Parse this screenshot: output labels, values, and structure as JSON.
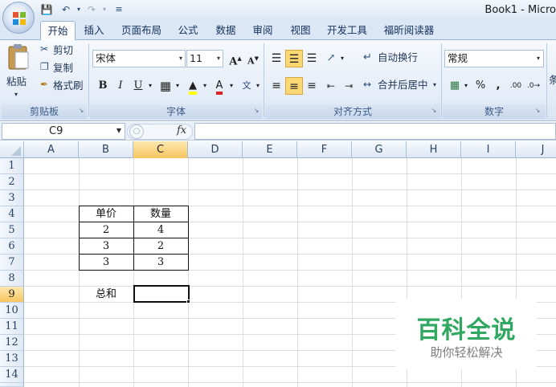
{
  "app": {
    "window_title": "Book1 - Micro",
    "quick_access": {
      "save_icon": "save-icon",
      "undo_icon": "undo-icon",
      "redo_icon": "redo-icon",
      "customize_icon": "customize-qat-icon"
    }
  },
  "tabs": [
    "开始",
    "插入",
    "页面布局",
    "公式",
    "数据",
    "审阅",
    "视图",
    "开发工具",
    "福昕阅读器"
  ],
  "active_tab": "开始",
  "ribbon": {
    "clipboard": {
      "paste": "粘贴",
      "cut": "剪切",
      "copy": "复制",
      "format_painter": "格式刷",
      "label": "剪贴板"
    },
    "font": {
      "name": "宋体",
      "size": "11",
      "label": "字体",
      "bold": "B",
      "italic": "I",
      "underline": "U"
    },
    "alignment": {
      "wrap_text": "自动换行",
      "merge_center": "合并后居中",
      "label": "对齐方式"
    },
    "number": {
      "format": "常规",
      "percent": "%",
      "comma": ",",
      "inc_decimal": ".00",
      "label": "数字"
    },
    "clipped_label": "条"
  },
  "formula_bar": {
    "name_box": "C9",
    "fx": "fx",
    "formula": ""
  },
  "grid": {
    "columns": [
      "A",
      "B",
      "C",
      "D",
      "E",
      "F",
      "G",
      "H",
      "I",
      "J"
    ],
    "rows": [
      "1",
      "2",
      "3",
      "4",
      "5",
      "6",
      "7",
      "8",
      "9",
      "10",
      "11",
      "12",
      "13",
      "14"
    ],
    "selected_cell": "C9",
    "cells": {
      "B4": "单价",
      "C4": "数量",
      "B5": "2",
      "C5": "4",
      "B6": "3",
      "C6": "2",
      "B7": "3",
      "C7": "3",
      "B9": "总和"
    }
  },
  "watermark": {
    "title": "百科全说",
    "subtitle": "助你轻松解决"
  },
  "colors": {
    "accent_tab": "#dce7f5",
    "selection_header": "#f7c65f",
    "watermark_green": "#2aa65a"
  }
}
